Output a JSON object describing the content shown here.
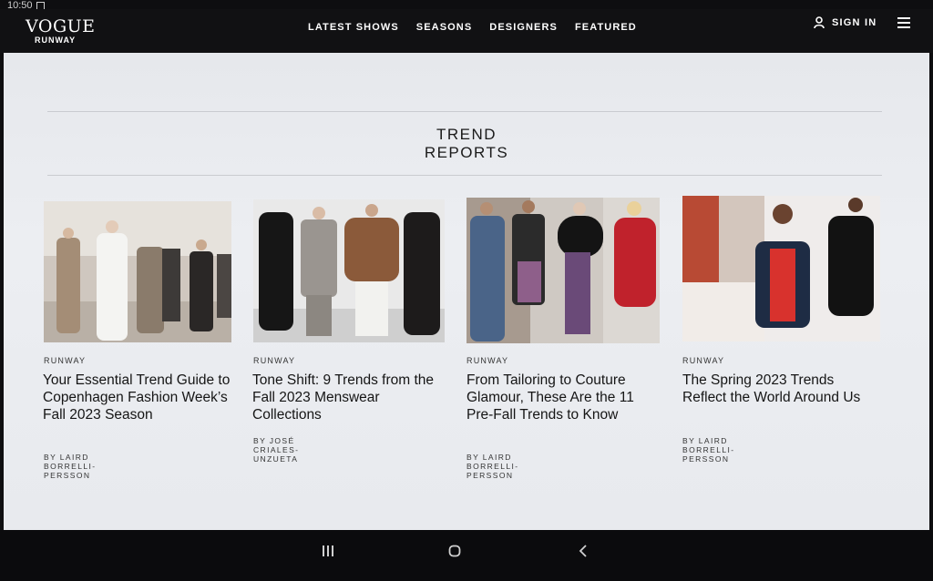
{
  "status": {
    "time": "10:50"
  },
  "header": {
    "logo_main": "VOGUE",
    "logo_sub": "RUNWAY",
    "nav": [
      "LATEST SHOWS",
      "SEASONS",
      "DESIGNERS",
      "FEATURED"
    ],
    "sign_in": "SIGN IN"
  },
  "section": {
    "title_line1": "TREND",
    "title_line2": "REPORTS"
  },
  "cards": [
    {
      "kicker": "RUNWAY",
      "title": "Your Essential Trend Guide to Copenhagen Fashion Week’s Fall 2023 Season",
      "byline": "BY LAIRD BORRELLI-PERSSON"
    },
    {
      "kicker": "RUNWAY",
      "title": "Tone Shift: 9 Trends from the Fall 2023 Menswear Collections",
      "byline": "BY JOSÉ CRIALES-UNZUETA"
    },
    {
      "kicker": "RUNWAY",
      "title": "From Tailoring to Couture Glamour, These Are the 11 Pre-Fall Trends to Know",
      "byline": "BY LAIRD BORRELLI-PERSSON"
    },
    {
      "kicker": "RUNWAY",
      "title": "The Spring 2023 Trends Reflect the World Around Us",
      "byline": "BY LAIRD BORRELLI-PERSSON"
    }
  ],
  "icons": {
    "user": "user-icon",
    "menu": "hamburger-menu-icon",
    "recents": "recent-apps-icon",
    "home": "home-icon",
    "back": "back-icon"
  }
}
